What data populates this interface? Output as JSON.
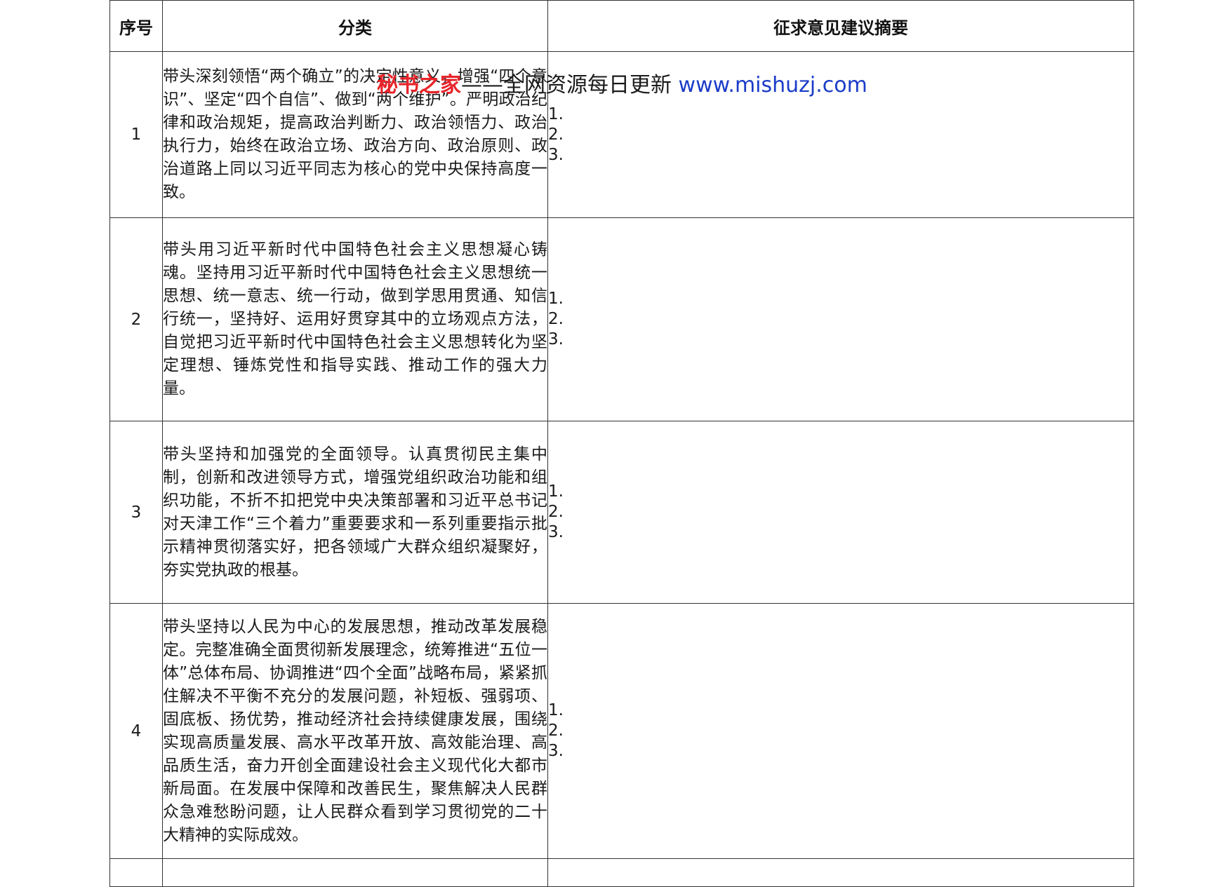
{
  "table": {
    "headers": [
      "序号",
      "分类",
      "征求意见建议摘要"
    ],
    "rows": [
      {
        "num": "1",
        "category": "带头深刻领悟“两个确立”的决定性意义，增强“四个意识”、坚定“四个自信”、做到“两个维护”。严明政治纪律和政治规矩，提高政治判断力、政治领悟力、政治执行力，始终在政治立场、政治方向、政治原则、政治道路上同以习近平同志为核心的党中央保持高度一致。",
        "suggestions": [
          "1.",
          "2.",
          "3."
        ]
      },
      {
        "num": "2",
        "category": "带头用习近平新时代中国特色社会主义思想凝心铸魂。坚持用习近平新时代中国特色社会主义思想统一思想、统一意志、统一行动，做到学思用贯通、知信行统一，坚持好、运用好贯穿其中的立场观点方法，自觉把习近平新时代中国特色社会主义思想转化为坚定理想、锤炼党性和指导实践、推动工作的强大力量。",
        "suggestions": [
          "1.",
          "2.",
          "3."
        ]
      },
      {
        "num": "3",
        "category": "带头坚持和加强党的全面领导。认真贯彻民主集中制，创新和改进领导方式，增强党组织政治功能和组织功能，不折不扣把党中央决策部署和习近平总书记对天津工作“三个着力”重要要求和一系列重要指示批示精神贯彻落实好，把各领域广大群众组织凝聚好，夯实党执政的根基。",
        "suggestions": [
          "1.",
          "2.",
          "3."
        ]
      },
      {
        "num": "4",
        "category": "带头坚持以人民为中心的发展思想，推动改革发展稳定。完整准确全面贯彻新发展理念，统筹推进“五位一体”总体布局、协调推进“四个全面”战略布局，紧紧抓住解决不平衡不充分的发展问题，补短板、强弱项、固底板、扬优势，推动经济社会持续健康发展，围绕实现高质量发展、高水平改革开放、高效能治理、高品质生活，奋力开创全面建设社会主义现代化大都市新局面。在发展中保障和改善民生，聚焦解决人民群众急难愁盼问题，让人民群众看到学习贯彻党的二十大精神的实际成效。",
        "suggestions": [
          "1.",
          "2.",
          "3."
        ]
      },
      {
        "num": "",
        "category": "",
        "suggestions": []
      }
    ]
  },
  "watermark": {
    "brand": "秘书之家",
    "text": "——全网资源每日更新 ",
    "url": "www.mishuzj.com"
  },
  "colors": {
    "border": "#333333",
    "watermark_brand": "#e8232a",
    "watermark_url": "#1a3cc8"
  }
}
